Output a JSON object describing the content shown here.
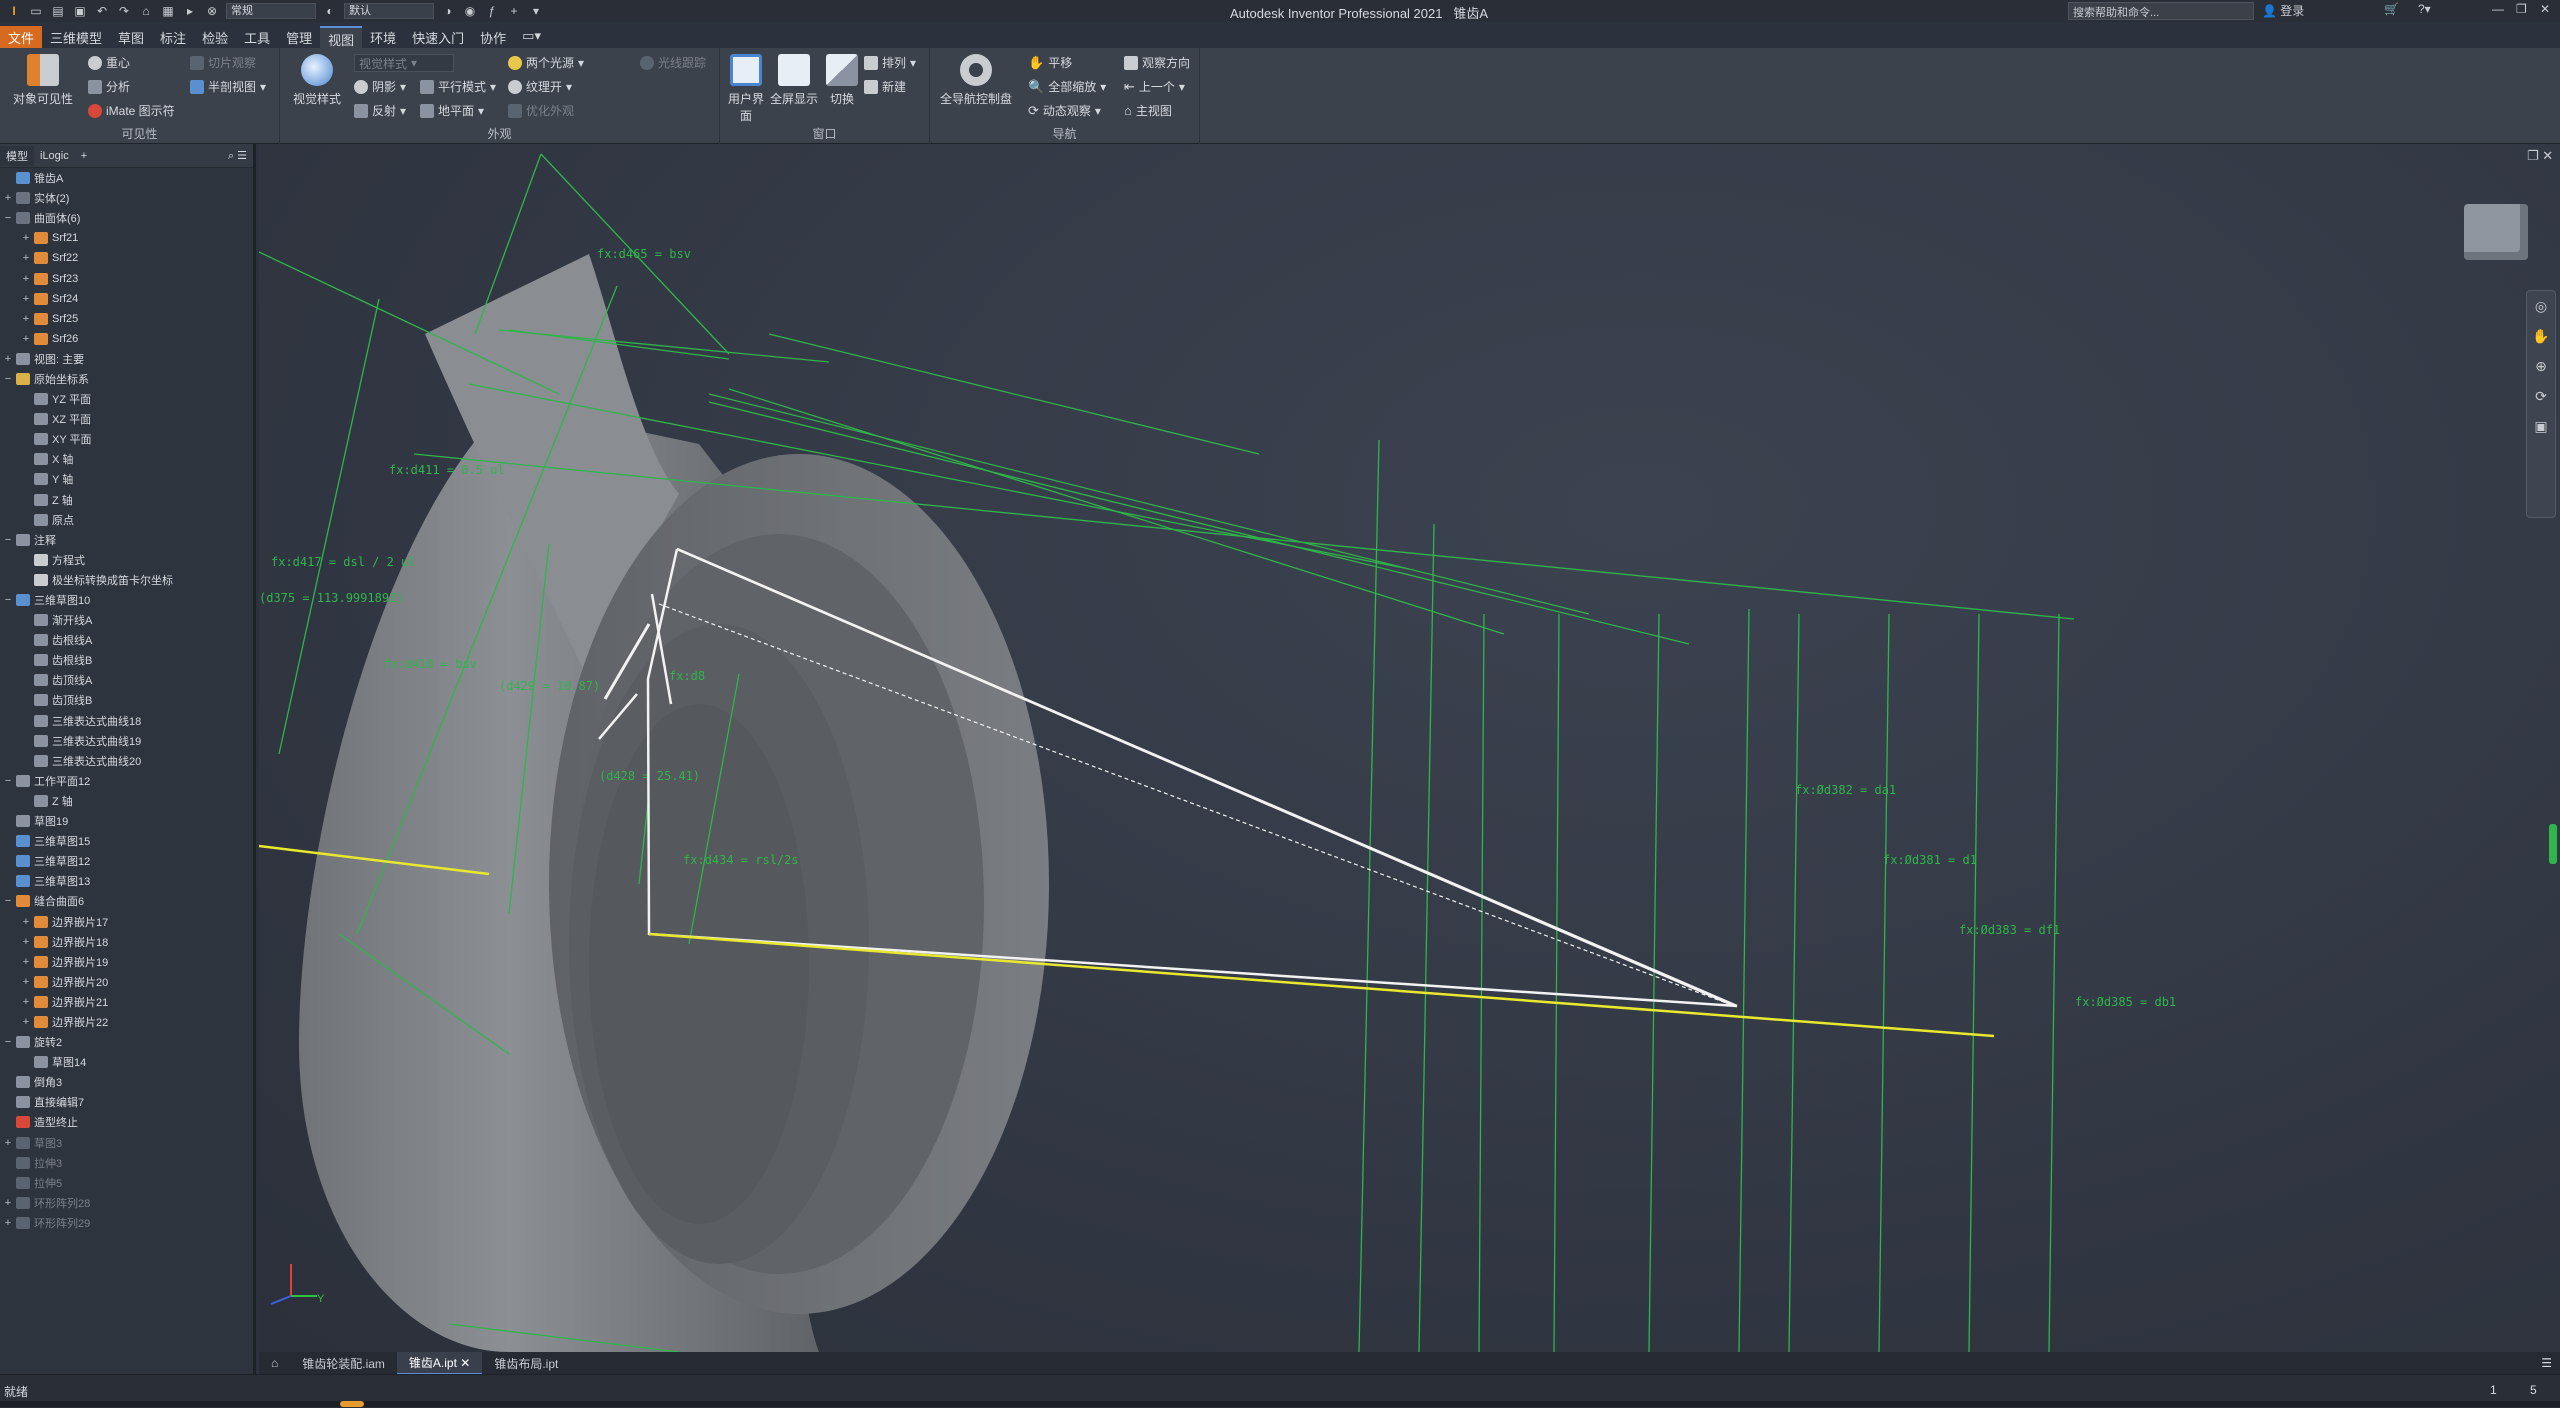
{
  "titlebar": {
    "app_title": "Autodesk Inventor Professional 2021",
    "document": "锥齿A",
    "appearance_combo": "常规",
    "material_combo": "默认",
    "search_placeholder": "搜索帮助和命令...",
    "login": "登录"
  },
  "menu_tabs": [
    "文件",
    "三维模型",
    "草图",
    "标注",
    "检验",
    "工具",
    "管理",
    "视图",
    "环境",
    "快速入门",
    "协作"
  ],
  "ribbon": {
    "visibility": {
      "label": "可见性",
      "object_visibility": "对象可见性",
      "center_of_gravity": "重心",
      "analysis": "分析",
      "imate": "iMate 图示符",
      "slice": "切片观察",
      "half_section": "半剖视图"
    },
    "appearance": {
      "label": "外观",
      "visual_style": "视觉样式",
      "style_combo": "视觉样式",
      "shadows": "阴影",
      "reflection": "反射",
      "parallel": "平行模式",
      "ground": "地平面",
      "lights": "两个光源",
      "texture": "纹理开",
      "ray": "光线跟踪",
      "optimize": "优化外观"
    },
    "window": {
      "label": "窗口",
      "user_interface": "用户界面",
      "fullscreen": "全屏显示",
      "switch": "切换",
      "arrange": "排列",
      "new": "新建"
    },
    "navigate": {
      "label": "导航",
      "full_nav": "全导航控制盘",
      "pan": "平移",
      "zoom_all": "全部缩放",
      "orbit": "动态观察",
      "look_at": "观察方向",
      "previous": "上一个",
      "home": "主视图"
    }
  },
  "browser": {
    "tabs": [
      "模型",
      "iLogic"
    ],
    "tree": [
      {
        "label": "锥齿A",
        "indent": 0,
        "exp": "",
        "icon": "#5a8fd0"
      },
      {
        "label": "实体(2)",
        "indent": 0,
        "exp": "+",
        "icon": "#6a7380"
      },
      {
        "label": "曲面体(6)",
        "indent": 0,
        "exp": "−",
        "icon": "#6a7380"
      },
      {
        "label": "Srf21",
        "indent": 1,
        "exp": "+",
        "icon": "#e08a3a"
      },
      {
        "label": "Srf22",
        "indent": 1,
        "exp": "+",
        "icon": "#e08a3a"
      },
      {
        "label": "Srf23",
        "indent": 1,
        "exp": "+",
        "icon": "#e08a3a"
      },
      {
        "label": "Srf24",
        "indent": 1,
        "exp": "+",
        "icon": "#e08a3a"
      },
      {
        "label": "Srf25",
        "indent": 1,
        "exp": "+",
        "icon": "#e08a3a"
      },
      {
        "label": "Srf26",
        "indent": 1,
        "exp": "+",
        "icon": "#e08a3a"
      },
      {
        "label": "视图: 主要",
        "indent": 0,
        "exp": "+",
        "icon": "#8a939f"
      },
      {
        "label": "原始坐标系",
        "indent": 0,
        "exp": "−",
        "icon": "#d9b24a"
      },
      {
        "label": "YZ 平面",
        "indent": 1,
        "exp": "",
        "icon": "#8a939f"
      },
      {
        "label": "XZ 平面",
        "indent": 1,
        "exp": "",
        "icon": "#8a939f"
      },
      {
        "label": "XY 平面",
        "indent": 1,
        "exp": "",
        "icon": "#8a939f"
      },
      {
        "label": "X 轴",
        "indent": 1,
        "exp": "",
        "icon": "#8a939f"
      },
      {
        "label": "Y 轴",
        "indent": 1,
        "exp": "",
        "icon": "#8a939f"
      },
      {
        "label": "Z 轴",
        "indent": 1,
        "exp": "",
        "icon": "#8a939f"
      },
      {
        "label": "原点",
        "indent": 1,
        "exp": "",
        "icon": "#8a939f"
      },
      {
        "label": "注释",
        "indent": 0,
        "exp": "−",
        "icon": "#8a939f"
      },
      {
        "label": "方程式",
        "indent": 1,
        "exp": "",
        "icon": "#c9ccd1"
      },
      {
        "label": "极坐标转换成笛卡尔坐标",
        "indent": 1,
        "exp": "",
        "icon": "#c9ccd1"
      },
      {
        "label": "三维草图10",
        "indent": 0,
        "exp": "−",
        "icon": "#5a8fd0"
      },
      {
        "label": "渐开线A",
        "indent": 1,
        "exp": "",
        "icon": "#8a939f"
      },
      {
        "label": "齿根线A",
        "indent": 1,
        "exp": "",
        "icon": "#8a939f"
      },
      {
        "label": "齿根线B",
        "indent": 1,
        "exp": "",
        "icon": "#8a939f"
      },
      {
        "label": "齿顶线A",
        "indent": 1,
        "exp": "",
        "icon": "#8a939f"
      },
      {
        "label": "齿顶线B",
        "indent": 1,
        "exp": "",
        "icon": "#8a939f"
      },
      {
        "label": "三维表达式曲线18",
        "indent": 1,
        "exp": "",
        "icon": "#8a939f"
      },
      {
        "label": "三维表达式曲线19",
        "indent": 1,
        "exp": "",
        "icon": "#8a939f"
      },
      {
        "label": "三维表达式曲线20",
        "indent": 1,
        "exp": "",
        "icon": "#8a939f"
      },
      {
        "label": "工作平面12",
        "indent": 0,
        "exp": "−",
        "icon": "#8a939f"
      },
      {
        "label": "Z 轴",
        "indent": 1,
        "exp": "",
        "icon": "#8a939f"
      },
      {
        "label": "草图19",
        "indent": 0,
        "exp": "",
        "icon": "#8a939f"
      },
      {
        "label": "三维草图15",
        "indent": 0,
        "exp": "",
        "icon": "#5a8fd0"
      },
      {
        "label": "三维草图12",
        "indent": 0,
        "exp": "",
        "icon": "#5a8fd0"
      },
      {
        "label": "三维草图13",
        "indent": 0,
        "exp": "",
        "icon": "#5a8fd0"
      },
      {
        "label": "缝合曲面6",
        "indent": 0,
        "exp": "−",
        "icon": "#e08a3a"
      },
      {
        "label": "边界嵌片17",
        "indent": 1,
        "exp": "+",
        "icon": "#e08a3a"
      },
      {
        "label": "边界嵌片18",
        "indent": 1,
        "exp": "+",
        "icon": "#e08a3a"
      },
      {
        "label": "边界嵌片19",
        "indent": 1,
        "exp": "+",
        "icon": "#e08a3a"
      },
      {
        "label": "边界嵌片20",
        "indent": 1,
        "exp": "+",
        "icon": "#e08a3a"
      },
      {
        "label": "边界嵌片21",
        "indent": 1,
        "exp": "+",
        "icon": "#e08a3a"
      },
      {
        "label": "边界嵌片22",
        "indent": 1,
        "exp": "+",
        "icon": "#e08a3a"
      },
      {
        "label": "旋转2",
        "indent": 0,
        "exp": "−",
        "icon": "#8a939f"
      },
      {
        "label": "草图14",
        "indent": 1,
        "exp": "",
        "icon": "#8a939f"
      },
      {
        "label": "倒角3",
        "indent": 0,
        "exp": "",
        "icon": "#8a939f"
      },
      {
        "label": "直接编辑7",
        "indent": 0,
        "exp": "",
        "icon": "#8a939f"
      },
      {
        "label": "造型终止",
        "indent": 0,
        "exp": "",
        "icon": "#d9473a"
      },
      {
        "label": "草图3",
        "indent": 0,
        "exp": "+",
        "icon": "#5a6370",
        "dim": true
      },
      {
        "label": "拉伸3",
        "indent": 0,
        "exp": "",
        "icon": "#5a6370",
        "dim": true
      },
      {
        "label": "拉伸5",
        "indent": 0,
        "exp": "",
        "icon": "#5a6370",
        "dim": true
      },
      {
        "label": "环形阵列28",
        "indent": 0,
        "exp": "+",
        "icon": "#5a6370",
        "dim": true
      },
      {
        "label": "环形阵列29",
        "indent": 0,
        "exp": "+",
        "icon": "#5a6370",
        "dim": true
      }
    ]
  },
  "viewport": {
    "dims": {
      "d465": "fx:d465 = bsv",
      "d411": "fx:d411 = 0.5 ul",
      "d417": "fx:d417 = dsl / 2 ul",
      "d375": "(d375 = 113.9991892)",
      "d410": "fx:d410 = bsv",
      "d429": "(d429 = 10.87)",
      "d428": "(d428 = 25.41)",
      "d434": "fx:d434 = rsl/2s",
      "d8": "fx:d8",
      "da2": "fx:Ød382 = da1",
      "d381": "fx:Ød381 = d1",
      "d383": "fx:Ød383 = df1",
      "d385": "fx:Ød385 = db1"
    }
  },
  "doc_tabs": [
    "锥齿轮装配.iam",
    "锥齿A.ipt",
    "锥齿布局.ipt"
  ],
  "status": {
    "text": "就绪",
    "count1": "1",
    "count2": "5"
  }
}
